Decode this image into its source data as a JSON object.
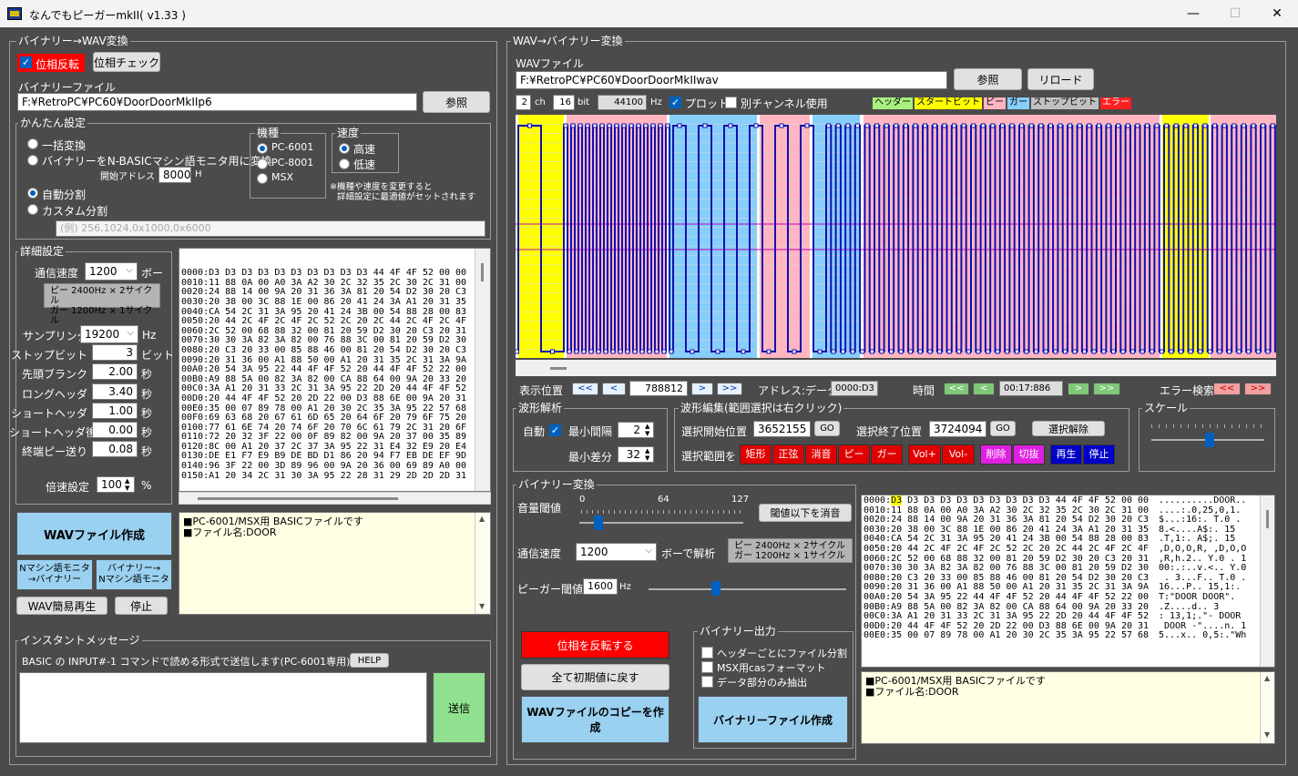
{
  "window": {
    "title": "なんでもピーガーmkII( v1.33 )",
    "min": "—",
    "max": "☐",
    "close": "✕"
  },
  "left": {
    "group_title": "バイナリー→WAV変換",
    "phase_invert": "位相反転",
    "phase_check": "位相チェック",
    "binfile_label": "バイナリーファイル",
    "binfile_value": "F:¥RetroPC¥PC60¥DoorDoorMkIIp6",
    "browse": "参照",
    "easy": {
      "title": "かんたん設定",
      "r1": "一括変換",
      "r2": "バイナリーをN-BASICマシン語モニタ用に変換",
      "start_addr_label": "開始アドレス",
      "start_addr": "8000",
      "start_addr_unit": "H",
      "r3": "自動分割",
      "r4": "カスタム分割",
      "custom_placeholder": "(例) 256,1024,0x1000,0x6000",
      "machine_title": "機種",
      "machines": [
        "PC-6001",
        "PC-8001",
        "MSX"
      ],
      "speed_title": "速度",
      "speeds": [
        "高速",
        "低速"
      ],
      "note1": "※機種や速度を変更すると",
      "note2": "詳細設定に最適値がセットされます"
    },
    "detail": {
      "title": "詳細設定",
      "baud_label": "通信速度",
      "baud": "1200",
      "baud_unit": "ボー",
      "info1": "ピー 2400Hz × 2サイクル",
      "info2": "ガー 1200Hz × 1サイクル",
      "sampling_label": "サンプリング",
      "sampling": "19200",
      "sampling_unit": "Hz",
      "rows": [
        {
          "label": "ストップビット",
          "value": "3",
          "unit": "ビット"
        },
        {
          "label": "先頭ブランク",
          "value": "2.00",
          "unit": "秒"
        },
        {
          "label": "ロングヘッダ",
          "value": "3.40",
          "unit": "秒"
        },
        {
          "label": "ショートヘッダ",
          "value": "1.00",
          "unit": "秒"
        },
        {
          "label": "ショートヘッダ後",
          "value": "0.00",
          "unit": "秒"
        },
        {
          "label": "終端ピー送り",
          "value": "0.08",
          "unit": "秒"
        }
      ],
      "mult_label": "倍速設定",
      "mult": "100",
      "mult_unit": "%"
    },
    "hex_lines": [
      "0000:D3 D3 D3 D3 D3 D3 D3 D3 D3 D3 44 4F 4F 52 00 00",
      "0010:11 88 0A 00 A0 3A A2 30 2C 32 35 2C 30 2C 31 00",
      "0020:24 88 14 00 9A 20 31 36 3A 81 20 54 D2 30 20 C3",
      "0030:20 38 00 3C 88 1E 00 86 20 41 24 3A A1 20 31 35",
      "0040:CA 54 2C 31 3A 95 20 41 24 3B 00 54 88 28 00 83",
      "0050:20 44 2C 4F 2C 4F 2C 52 2C 20 2C 44 2C 4F 2C 4F",
      "0060:2C 52 00 68 88 32 00 81 20 59 D2 30 20 C3 20 31",
      "0070:30 30 3A 82 3A 82 00 76 88 3C 00 81 20 59 D2 30",
      "0080:20 C3 20 33 00 85 88 46 00 81 20 54 D2 30 20 C3",
      "0090:20 31 36 00 A1 88 50 00 A1 20 31 35 2C 31 3A 9A",
      "00A0:20 54 3A 95 22 44 4F 4F 52 20 44 4F 4F 52 22 00",
      "00B0:A9 88 5A 00 82 3A 82 00 CA 88 64 00 9A 20 33 20",
      "00C0:3A A1 20 31 33 2C 31 3A 95 22 2D 20 44 4F 4F 52",
      "00D0:20 44 4F 4F 52 20 2D 22 00 D3 88 6E 00 9A 20 31",
      "00E0:35 00 07 89 78 00 A1 20 30 2C 35 3A 95 22 57 68",
      "00F0:69 63 68 20 67 61 6D 65 20 64 6F 20 79 6F 75 20",
      "0100:77 61 6E 74 20 74 6F 20 70 6C 61 79 2C 31 20 6F",
      "0110:72 20 32 3F 22 00 0F 89 82 00 9A 20 37 00 35 89",
      "0120:8C 00 A1 20 37 2C 37 3A 95 22 31 E4 32 E9 20 E4",
      "0130:DE E1 F7 E9 B9 DE BD D1 86 20 94 F7 EB DE EF 9D",
      "0140:96 3F 22 00 3D 89 96 00 9A 20 36 00 69 89 A0 00",
      "0150:A1 20 34 2C 31 30 3A 95 22 28 31 29 2D 2D 2D 31"
    ],
    "info_lines": "■PC-6001/MSX用 BASICファイルです\n■ファイル名:DOOR",
    "create_wav": "WAVファイル作成",
    "nmon_to_bin": "Nマシン語モニタ\n→バイナリー",
    "bin_to_nmon": "バイナリー→\nNマシン語モニタ",
    "wav_play": "WAV簡易再生",
    "stop": "停止",
    "instant_title": "インスタントメッセージ",
    "instant_desc": "BASIC の INPUT#-1 コマンドで読める形式で送信します(PC-6001専用)",
    "help": "HELP",
    "send": "送信"
  },
  "right": {
    "group_title": "WAV→バイナリー変換",
    "wav_label": "WAVファイル",
    "wav_value": "F:¥RetroPC¥PC60¥DoorDoorMkIIwav",
    "browse": "参照",
    "reload": "リロード",
    "ch": "2",
    "ch_unit": "ch",
    "bit": "16",
    "bit_unit": "bit",
    "hz": "44100",
    "hz_unit": "Hz",
    "plot": "プロット",
    "other_ch": "別チャンネル使用",
    "legend": [
      {
        "label": "ヘッダー",
        "color": "#a8f080"
      },
      {
        "label": "スタートビット",
        "color": "#ffff00"
      },
      {
        "label": "ピー",
        "color": "#ffb6c1"
      },
      {
        "label": "ガー",
        "color": "#87cefa"
      },
      {
        "label": "ストップビット",
        "color": "#c0c0c0"
      },
      {
        "label": "エラー",
        "color": "#ff2020"
      }
    ],
    "pos_label": "表示位置",
    "pos_value": "788812",
    "addr_label": "アドレス:データ",
    "addr_value": "0000:D3",
    "time_label": "時間",
    "time_value": "00:17:886",
    "err_label": "エラー検索",
    "nav_prev2": "<<",
    "nav_prev": "<",
    "nav_next": ">",
    "nav_next2": ">>",
    "wave_title": "波形解析",
    "auto": "自動",
    "min_int_label": "最小間隔",
    "min_int": "2",
    "min_diff_label": "最小差分",
    "min_diff": "32",
    "edit_title": "波形編集(範囲選択は右クリック)",
    "sel_start_label": "選択開始位置",
    "sel_start": "3652155",
    "sel_end_label": "選択終了位置",
    "sel_end": "3724094",
    "go": "GO",
    "sel_clear": "選択解除",
    "sel_range": "選択範囲を",
    "edit_buttons": [
      {
        "label": "矩形",
        "color": "#e00000"
      },
      {
        "label": "正弦",
        "color": "#e00000"
      },
      {
        "label": "消音",
        "color": "#e00000"
      },
      {
        "label": "ピー",
        "color": "#e00000"
      },
      {
        "label": "ガー",
        "color": "#e00000"
      },
      {
        "label": "Vol+",
        "color": "#e00000"
      },
      {
        "label": "Vol-",
        "color": "#e00000"
      },
      {
        "label": "削除",
        "color": "#e020e0"
      },
      {
        "label": "切抜",
        "color": "#e020e0"
      },
      {
        "label": "再生",
        "color": "#0000c8"
      },
      {
        "label": "停止",
        "color": "#0000c8"
      }
    ],
    "scale_title": "スケール",
    "conv_title": "バイナリー変換",
    "vol_label": "音量閾値",
    "vol_ticks": [
      "0",
      "64",
      "127"
    ],
    "vol_level": 22,
    "below_mute": "閾値以下を消音",
    "baud_label": "通信速度",
    "baud": "1200",
    "baud_unit": "ボーで解析",
    "info1": "ピー 2400Hz × 2サイクル",
    "info2": "ガー 1200Hz × 1サイクル",
    "pg_label": "ピーガー閾値",
    "pg_value": "1600",
    "pg_unit": "Hz",
    "pg_level": 1600,
    "invert_phase": "位相を反転する",
    "reset": "全て初期値に戻す",
    "copy_wav": "WAVファイルのコピーを作成",
    "out_title": "バイナリー出力",
    "out1": "ヘッダーごとにファイル分割",
    "out2": "MSX用casフォーマット",
    "out3": "データ部分のみ抽出",
    "make_bin": "バイナリーファイル作成",
    "hex_lines": [
      "0000:D3 D3 D3 D3 D3 D3 D3 D3 D3 D3 44 4F 4F 52 00 00",
      "0010:11 88 0A 00 A0 3A A2 30 2C 32 35 2C 30 2C 31 00",
      "0020:24 88 14 00 9A 20 31 36 3A 81 20 54 D2 30 20 C3",
      "0030:20 38 00 3C 88 1E 00 86 20 41 24 3A A1 20 31 35",
      "0040:CA 54 2C 31 3A 95 20 41 24 3B 00 54 88 28 00 83",
      "0050:20 44 2C 4F 2C 4F 2C 52 2C 20 2C 44 2C 4F 2C 4F",
      "0060:2C 52 00 68 88 32 00 81 20 59 D2 30 20 C3 20 31",
      "0070:30 30 3A 82 3A 82 00 76 88 3C 00 81 20 59 D2 30",
      "0080:20 C3 20 33 00 85 88 46 00 81 20 54 D2 30 20 C3",
      "0090:20 31 36 00 A1 88 50 00 A1 20 31 35 2C 31 3A 9A",
      "00A0:20 54 3A 95 22 44 4F 4F 52 20 44 4F 4F 52 22 00",
      "00B0:A9 88 5A 00 82 3A 82 00 CA 88 64 00 9A 20 33 20",
      "00C0:3A A1 20 31 33 2C 31 3A 95 22 2D 20 44 4F 4F 52",
      "00D0:20 44 4F 4F 52 20 2D 22 00 D3 88 6E 00 9A 20 31",
      "00E0:35 00 07 89 78 00 A1 20 30 2C 35 3A 95 22 57 68"
    ],
    "ascii_lines": [
      "..........DOOR..",
      "....:.0,25,0,1.",
      "$...:16:. T.0 .",
      "8.<....A$:. 15",
      ".T,1:. A$;. 15",
      ",D,O,O,R, ,D,O,O",
      ",R,h.2.. Y.0 . 1",
      "00:.:..v.<.. Y.0",
      " . 3...F.. T.0 .",
      "16...P.. 15,1:.",
      "T:\"DOOR DOOR\".",
      ".Z....d.. 3 ",
      ": 13,1;.\"- DOOR",
      " DOOR -\"....n. 1",
      "5...x.. 0,5:.\"Wh"
    ],
    "info_lines": "■PC-6001/MSX用 BASICファイルです\n■ファイル名:DOOR"
  }
}
